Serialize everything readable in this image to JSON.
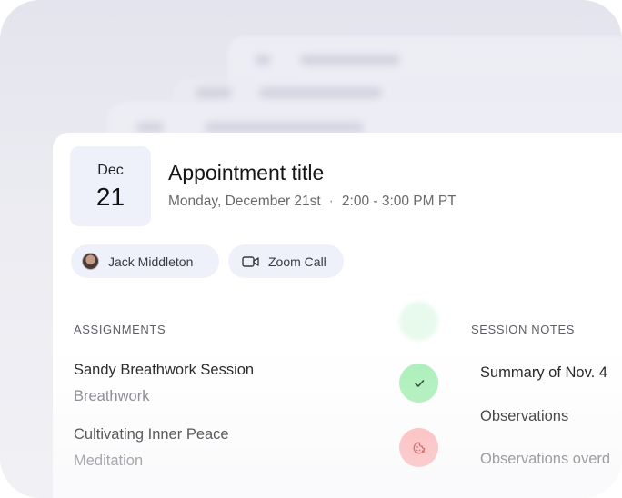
{
  "appointment": {
    "date": {
      "month": "Dec",
      "day": "21"
    },
    "title": "Appointment title",
    "day_label": "Monday, December 21st",
    "separator": "·",
    "time_range": "2:00 - 3:00 PM PT"
  },
  "chips": {
    "client_name": "Jack Middleton",
    "meeting_type": "Zoom Call"
  },
  "assignments": {
    "heading": "ASSIGNMENTS",
    "items": [
      {
        "title": "Sandy Breathwork Session",
        "category": "Breathwork",
        "status": "completed",
        "status_color": "#a9efb7",
        "status_icon": "check-icon"
      },
      {
        "title": "Cultivating Inner Peace",
        "category": "Meditation",
        "status": "pending",
        "status_color": "#ffb3b3",
        "status_icon": "cookie-icon"
      }
    ]
  },
  "session_notes": {
    "heading": "SESSION NOTES",
    "items": [
      {
        "label": "Summary of  Nov. 4"
      },
      {
        "label": "Observations"
      },
      {
        "label": "Observations overd"
      }
    ]
  },
  "colors": {
    "tile_bg": "#eef1fa",
    "completed": "#a9efb7",
    "pending": "#ffb3b3"
  }
}
